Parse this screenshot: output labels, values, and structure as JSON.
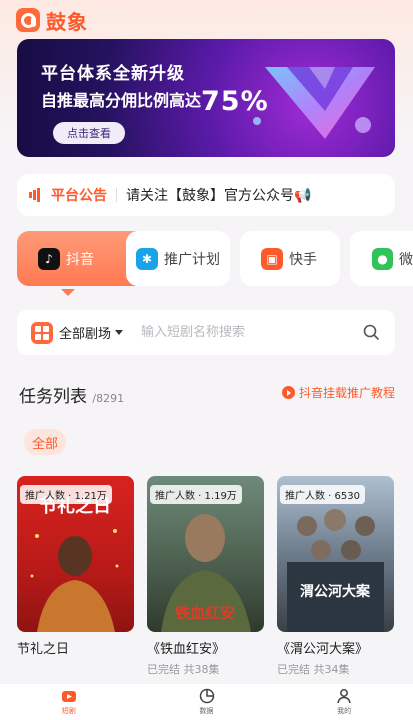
{
  "app": {
    "name": "鼓象"
  },
  "banner": {
    "title": "平台体系全新升级",
    "subtitle": "自推最高分佣比例高达",
    "percent": "75%",
    "button_label": "点击查看"
  },
  "notice": {
    "tag": "平台公告",
    "text": "请关注【鼓象】官方公众号📢"
  },
  "platform_tabs": [
    {
      "label": "抖音",
      "icon": "douyin-icon",
      "active": true
    },
    {
      "label": "推广计划",
      "icon": "promotion-plan-icon",
      "active": false
    },
    {
      "label": "快手",
      "icon": "kuaishou-icon",
      "active": false
    },
    {
      "label": "微",
      "icon": "wechat-icon",
      "active": false
    }
  ],
  "filter": {
    "label": "全部剧场",
    "search_placeholder": "输入短剧名称搜索"
  },
  "task_list": {
    "title": "任务列表",
    "count": "/8291",
    "tutorial_link": "抖音挂载推广教程",
    "chip": "全部"
  },
  "cards": [
    {
      "badge": "推广人数 · 1.21万",
      "poster_text": "节礼之日",
      "title": "节礼之日",
      "status": ""
    },
    {
      "badge": "推广人数 · 1.19万",
      "poster_text": "铁血红安",
      "title": "《铁血红安》",
      "status": "已完结 共38集"
    },
    {
      "badge": "推广人数 · 6530",
      "poster_text": "渭公河大案",
      "title": "《渭公河大案》",
      "status": "已完结 共34集"
    }
  ],
  "bottom_nav": [
    {
      "label": "短剧",
      "icon": "drama-icon",
      "active": true
    },
    {
      "label": "数据",
      "icon": "data-icon",
      "active": false
    },
    {
      "label": "我的",
      "icon": "profile-icon",
      "active": false
    }
  ],
  "colors": {
    "accent": "#ff5a2c",
    "accent_light": "#fde4dc",
    "banner_dark": "#24125e"
  }
}
